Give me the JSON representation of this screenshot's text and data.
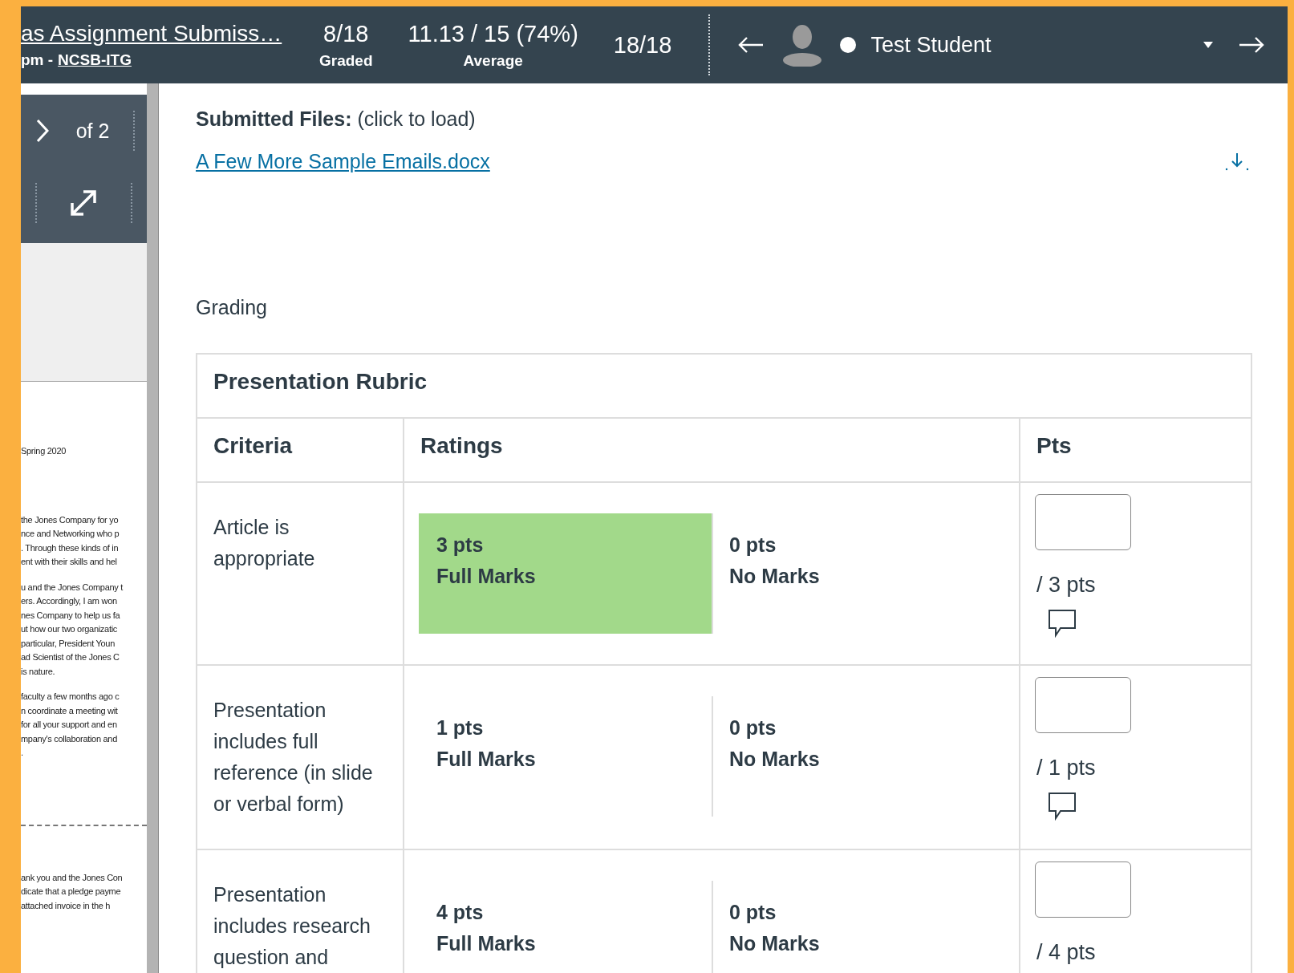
{
  "header": {
    "assignment_title": "as Assignment Submiss…",
    "subtitle_prefix": "pm - ",
    "course_link": "NCSB-ITG",
    "stats": [
      {
        "value": "8/18",
        "label": "Graded"
      },
      {
        "value": "11.13 / 15 (74%)",
        "label": "Average"
      },
      {
        "value": "18/18"
      }
    ],
    "student": {
      "name": "Test Student"
    }
  },
  "preview": {
    "page_count": "of 2",
    "document": {
      "heading": "Spring 2020",
      "paragraphs": [
        [
          "the Jones Company for yo",
          "nce and Networking who p",
          ". Through these kinds of in",
          "ent with their skills and hel"
        ],
        [
          "u and the Jones Company t",
          "ers. Accordingly, I am won",
          "nes Company to help us fa",
          "ut how our two organizatic",
          "particular, President Youn",
          "ad Scientist of the Jones C",
          "is nature."
        ],
        [
          "faculty a few months ago c",
          "n coordinate a meeting wit",
          "for all your support and en",
          "mpany's collaboration and",
          "."
        ],
        [
          "ank you and the Jones Con",
          "dicate that a pledge payme",
          "attached invoice in the h"
        ]
      ]
    }
  },
  "submitted_files": {
    "label": "Submitted Files:",
    "hint": "(click to load)",
    "files": [
      "A Few More Sample Emails.docx"
    ]
  },
  "grading": {
    "heading": "Grading",
    "rubric": {
      "title": "Presentation Rubric",
      "columns": [
        "Criteria",
        "Ratings",
        "Pts"
      ],
      "rows": [
        {
          "criterion": "Article is appropriate",
          "ratings": [
            {
              "points": "3 pts",
              "description": "Full Marks",
              "selected": true
            },
            {
              "points": "0 pts",
              "description": "No Marks",
              "selected": false
            }
          ],
          "max": "/ 3 pts"
        },
        {
          "criterion": "Presentation includes full reference (in slide or verbal form)",
          "ratings": [
            {
              "points": "1 pts",
              "description": "Full Marks",
              "selected": false
            },
            {
              "points": "0 pts",
              "description": "No Marks",
              "selected": false
            }
          ],
          "max": "/ 1 pts"
        },
        {
          "criterion": "Presentation includes research question and",
          "ratings": [
            {
              "points": "4 pts",
              "description": "Full Marks",
              "selected": false
            },
            {
              "points": "0 pts",
              "description": "No Marks",
              "selected": false
            }
          ],
          "max": "/ 4 pts"
        }
      ]
    }
  }
}
